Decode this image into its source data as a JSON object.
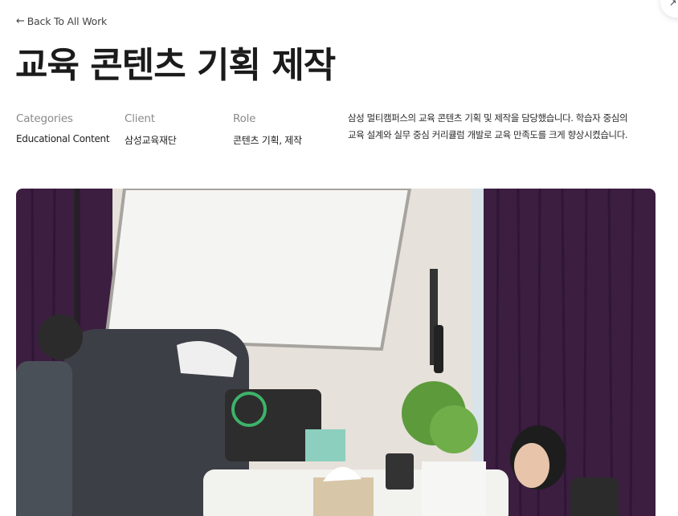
{
  "nav": {
    "back_label": "Back To All Work",
    "back_icon": "arrow-left-icon",
    "corner_glyph": "↗"
  },
  "project": {
    "title": "교육 콘텐츠 기획 제작",
    "meta": [
      {
        "label": "Categories",
        "value": "Educational Content"
      },
      {
        "label": "Client",
        "value": "삼성교육재단"
      },
      {
        "label": "Role",
        "value": "콘텐츠 기획, 제작"
      }
    ],
    "description_lines": [
      "삼성 멀티캠퍼스의 교육 콘텐츠 기획 및 제작을 담당했습니다. 학습자 중심의",
      "교육 설계와 실무 중심 커리큘럼 개발로 교육 만족도를 크게 향상시켰습니다."
    ]
  },
  "colors": {
    "text": "#1b1b1b",
    "muted": "#8a8a8a",
    "curtain": "#3a1f3f",
    "wall": "#e8e4de"
  }
}
